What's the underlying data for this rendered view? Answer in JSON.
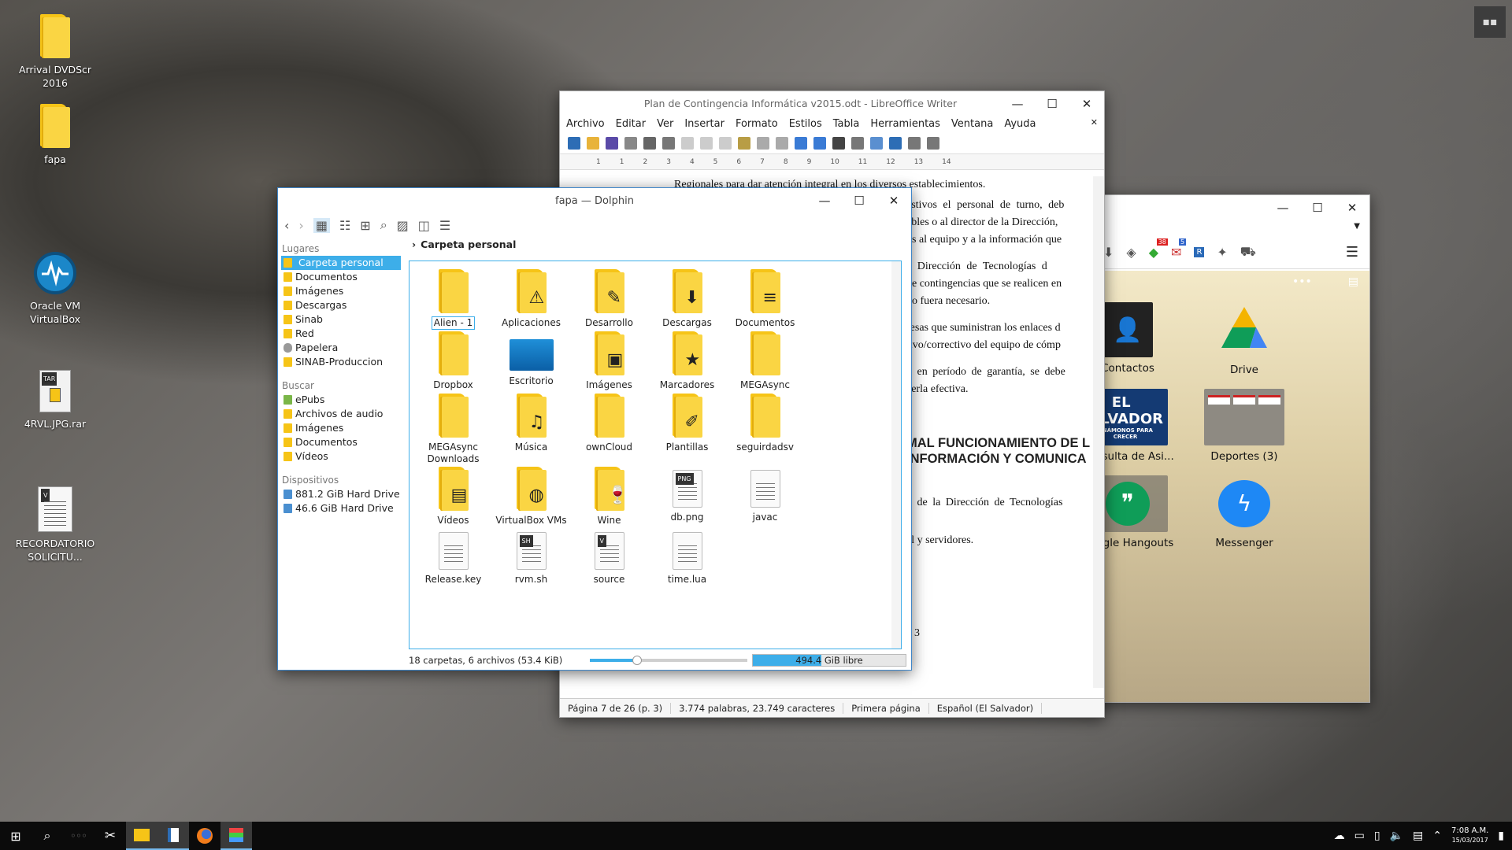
{
  "desktop": {
    "icons": [
      {
        "label": "Arrival DVDScr 2016",
        "icon": "folder-icon"
      },
      {
        "label": "fapa",
        "icon": "folder-icon"
      },
      {
        "label": "Oracle VM VirtualBox",
        "icon": "virtualbox-icon"
      },
      {
        "label": "4RVL.JPG.rar",
        "icon": "rar-archive-icon",
        "badge": "TAR"
      },
      {
        "label": "RECORDATORIO SOLICITU...",
        "icon": "document-icon",
        "badge": "V"
      }
    ]
  },
  "writer": {
    "title": "Plan de Contingencia Informática v2015.odt - LibreOffice Writer",
    "menu": [
      "Archivo",
      "Editar",
      "Ver",
      "Insertar",
      "Formato",
      "Estilos",
      "Tabla",
      "Herramientas",
      "Ventana",
      "Ayuda"
    ],
    "ruler_numbers": [
      "1",
      "1",
      "2",
      "3",
      "4",
      "5",
      "6",
      "7",
      "8",
      "9",
      "10",
      "11",
      "12",
      "13",
      "14"
    ],
    "text_lines": [
      "Regionales para dar atención integral en los diversos establecimientos.",
      "estivos el personal de turno, deb",
      "ables o al director de la Dirección, ",
      "os al equipo y a la información que",
      "a Dirección de Tecnologías d",
      "de contingencias que se realicen en",
      "do fuera necesario.",
      "resas que suministran los enlaces d",
      "tivo/correctivo del equipo de cómp",
      "n en período de garantía, se debe",
      "cerla efectiva.",
      "MAL FUNCIONAMIENTO DE L",
      "INFORMACIÓN Y COMUNICA",
      "o de la Dirección de Tecnologías",
      "al y servidores.",
      "3"
    ],
    "status": {
      "page": "Página 7 de 26 (p. 3)",
      "words": "3.774 palabras, 23.749 caracteres",
      "style": "Primera página",
      "language": "Español (El Salvador)"
    }
  },
  "dolphin": {
    "title": "fapa — Dolphin",
    "breadcrumb": "Carpeta personal",
    "places": {
      "header": "Lugares",
      "items": [
        "Carpeta personal",
        "Documentos",
        "Imágenes",
        "Descargas",
        "Sinab",
        "Red",
        "Papelera",
        "SINAB-Produccion"
      ]
    },
    "search": {
      "header": "Buscar",
      "items": [
        "ePubs",
        "Archivos de audio",
        "Imágenes",
        "Documentos",
        "Vídeos"
      ]
    },
    "devices": {
      "header": "Dispositivos",
      "items": [
        "881.2 GiB Hard Drive",
        "46.6 GiB Hard Drive"
      ]
    },
    "files": [
      {
        "name": "Alien - 1",
        "kind": "folder",
        "emblem": ""
      },
      {
        "name": "Aplicaciones",
        "kind": "folder",
        "emblem": "⚠"
      },
      {
        "name": "Desarrollo",
        "kind": "folder",
        "emblem": "✎"
      },
      {
        "name": "Descargas",
        "kind": "folder",
        "emblem": "⬇"
      },
      {
        "name": "Documentos",
        "kind": "folder",
        "emblem": "≡"
      },
      {
        "name": "Dropbox",
        "kind": "folder",
        "emblem": ""
      },
      {
        "name": "Escritorio",
        "kind": "desktop",
        "emblem": ""
      },
      {
        "name": "Imágenes",
        "kind": "folder",
        "emblem": "▣"
      },
      {
        "name": "Marcadores",
        "kind": "folder",
        "emblem": "★"
      },
      {
        "name": "MEGAsync",
        "kind": "folder",
        "emblem": ""
      },
      {
        "name": "MEGAsync Downloads",
        "kind": "folder",
        "emblem": ""
      },
      {
        "name": "Música",
        "kind": "folder",
        "emblem": "♫"
      },
      {
        "name": "ownCloud",
        "kind": "folder",
        "emblem": ""
      },
      {
        "name": "Plantillas",
        "kind": "folder",
        "emblem": "✐"
      },
      {
        "name": "seguirdadsv",
        "kind": "folder",
        "emblem": ""
      },
      {
        "name": "Vídeos",
        "kind": "folder",
        "emblem": "▤"
      },
      {
        "name": "VirtualBox VMs",
        "kind": "folder",
        "emblem": "◍"
      },
      {
        "name": "Wine",
        "kind": "folder",
        "emblem": "🍷"
      },
      {
        "name": "db.png",
        "kind": "file",
        "emblem": "PNG"
      },
      {
        "name": "javac",
        "kind": "file",
        "emblem": ""
      },
      {
        "name": "Release.key",
        "kind": "file",
        "emblem": ""
      },
      {
        "name": "rvm.sh",
        "kind": "file",
        "emblem": "SH"
      },
      {
        "name": "source",
        "kind": "file",
        "emblem": "V"
      },
      {
        "name": "time.lua",
        "kind": "file",
        "emblem": ""
      }
    ],
    "status": {
      "summary": "18 carpetas, 6 archivos (53.4 KiB)",
      "free": "494.4 GiB libre",
      "free_fraction": 0.45
    }
  },
  "launcher": {
    "badges": {
      "gmail": "5",
      "other": "38"
    },
    "tiles": [
      "Contactos",
      "Drive",
      "Consulta de Asi...",
      "Deportes (3)",
      "Google Hangouts",
      "Messenger"
    ],
    "tile_banner": "EL SALVADOR",
    "tile_banner_sub": "UNÁMONOS PARA CRECER"
  },
  "taskbar": {
    "clock_time": "7:08 A.M.",
    "clock_date": "15/03/2017"
  },
  "colors": {
    "accent": "#3daee9",
    "window_border": "#3f86c9",
    "folder": "#f6c417",
    "taskbar": "#0b0b0b"
  }
}
